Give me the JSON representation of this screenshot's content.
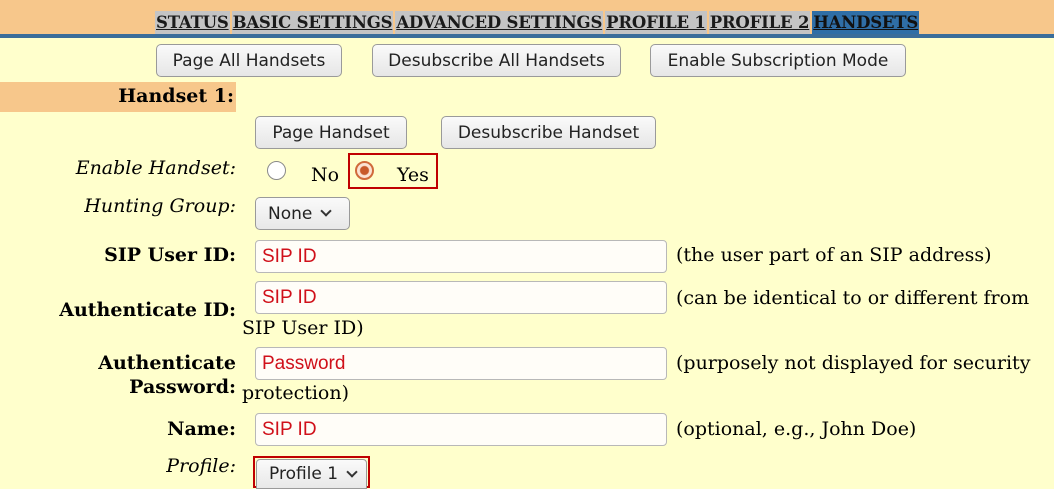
{
  "nav": {
    "items": [
      "STATUS",
      "BASIC SETTINGS",
      "ADVANCED SETTINGS",
      "PROFILE 1",
      "PROFILE 2",
      "HANDSETS"
    ],
    "active": "HANDSETS"
  },
  "toolbar": {
    "page_all": "Page All Handsets",
    "desubscribe_all": "Desubscribe All Handsets",
    "enable_subscription": "Enable Subscription Mode"
  },
  "handset": {
    "title": "Handset 1:",
    "page_button": "Page Handset",
    "desubscribe_button": "Desubscribe Handset",
    "enable": {
      "label": "Enable Handset:",
      "options": [
        "No",
        "Yes"
      ],
      "selected": "Yes"
    },
    "hunting_group": {
      "label": "Hunting Group:",
      "value": "None"
    },
    "sip_user_id": {
      "label": "SIP User ID:",
      "value": "SIP ID",
      "hint": "(the user part of an SIP address)"
    },
    "authenticate_id": {
      "label": "Authenticate ID:",
      "value": "SIP ID",
      "hint_line1": "(can be identical to or different from",
      "hint_line2": "SIP User ID)"
    },
    "authenticate_password": {
      "label_line1": "Authenticate",
      "label_line2": "Password:",
      "value": "Password",
      "hint_line1": "(purposely not displayed for security",
      "hint_line2": "protection)"
    },
    "name": {
      "label": "Name:",
      "value": "SIP ID",
      "hint": "(optional, e.g., John Doe)"
    },
    "profile": {
      "label": "Profile:",
      "value": "Profile 1"
    }
  },
  "colors": {
    "page_background": "#ffffcc",
    "header_band": "#f7c78b",
    "nav_rule": "#3a6d9a",
    "active_tab": "#2f6ea6",
    "input_text": "#d0101a",
    "highlight_border": "#c00000"
  }
}
